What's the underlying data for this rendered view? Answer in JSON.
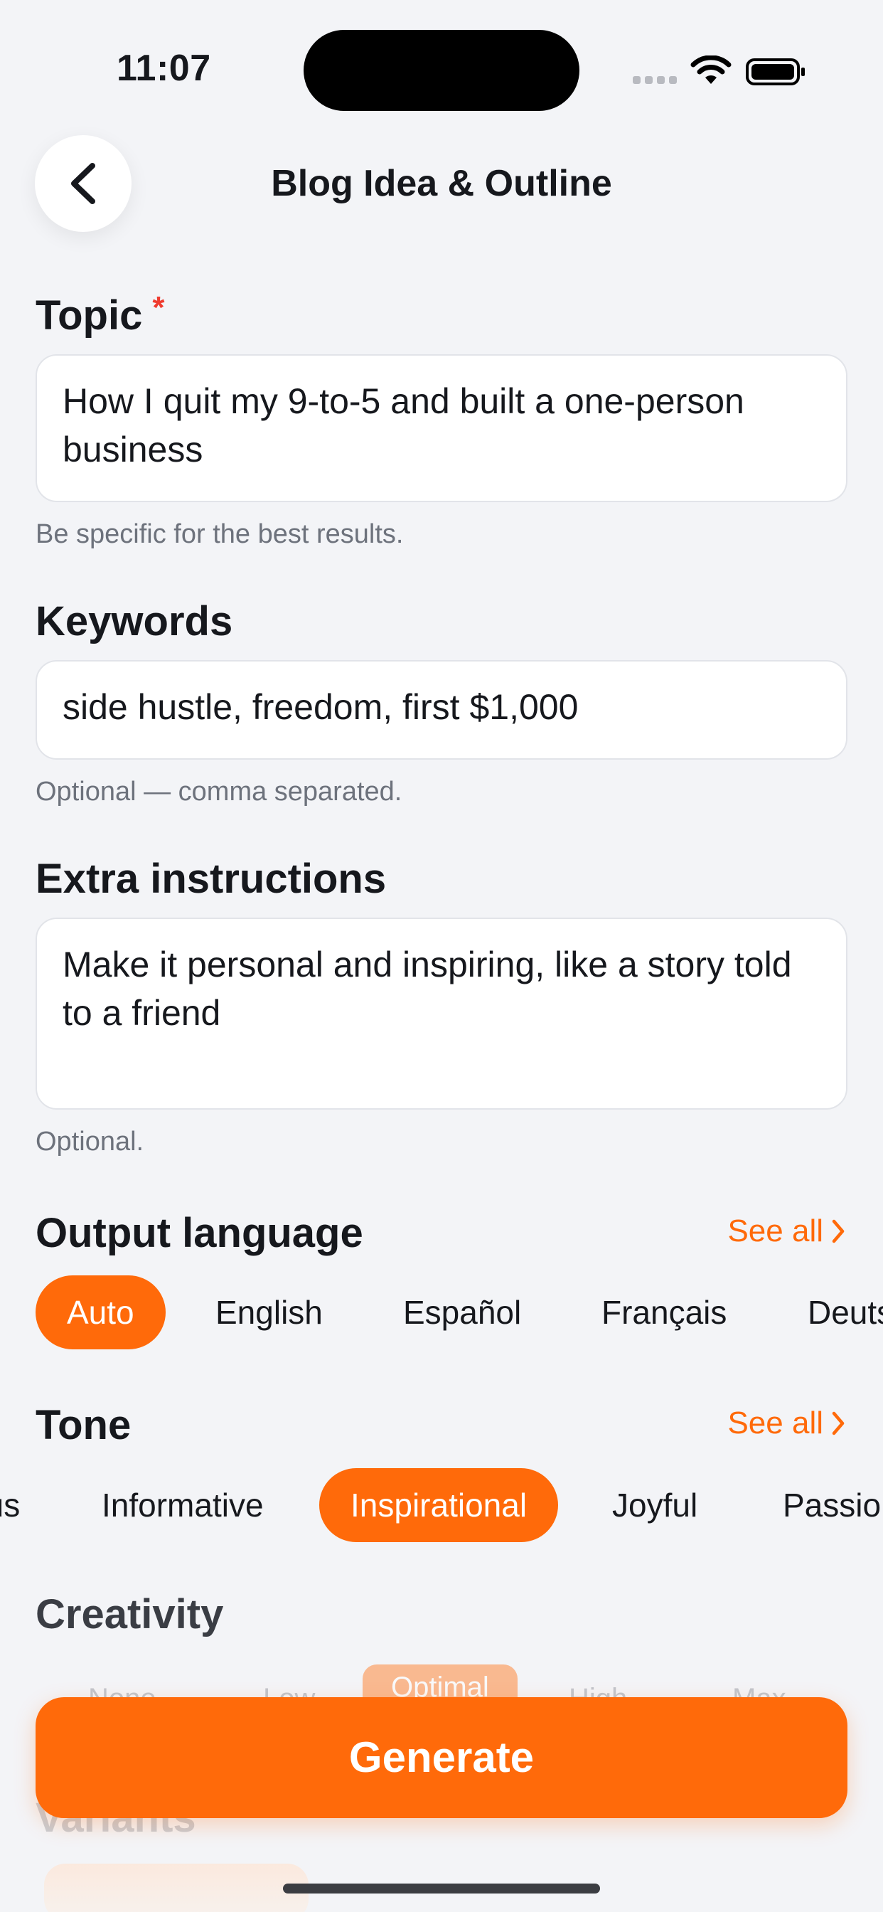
{
  "status_bar": {
    "time": "11:07"
  },
  "header": {
    "title": "Blog Idea & Outline"
  },
  "topic": {
    "label": "Topic",
    "required_marker": "*",
    "value": "How I quit my 9-to-5 and built a one-person business",
    "helper": "Be specific for the best results."
  },
  "keywords": {
    "label": "Keywords",
    "value": "side hustle, freedom, first $1,000",
    "helper": "Optional — comma separated."
  },
  "extra": {
    "label": "Extra instructions",
    "value": "Make it personal and inspiring, like a story told to a friend",
    "helper": "Optional."
  },
  "language": {
    "label": "Output language",
    "see_all": "See all",
    "options": [
      "Auto",
      "English",
      "Español",
      "Français",
      "Deutsch"
    ],
    "selected": "Auto"
  },
  "tone": {
    "label": "Tone",
    "see_all": "See all",
    "options": [
      "Humorous",
      "Informative",
      "Inspirational",
      "Joyful",
      "Passionate"
    ],
    "selected": "Inspirational"
  },
  "creativity": {
    "label": "Creativity",
    "options": [
      "None",
      "Low",
      "Optimal",
      "High",
      "Max"
    ],
    "selected": "Optimal"
  },
  "variants": {
    "label": "Variants"
  },
  "generate": {
    "label": "Generate"
  },
  "colors": {
    "accent": "#ff6a0a",
    "background": "#f3f4f7",
    "required": "#ef3b2f"
  },
  "icons": [
    "back-chevron-icon",
    "wifi-icon",
    "battery-icon",
    "chevron-right-icon"
  ]
}
